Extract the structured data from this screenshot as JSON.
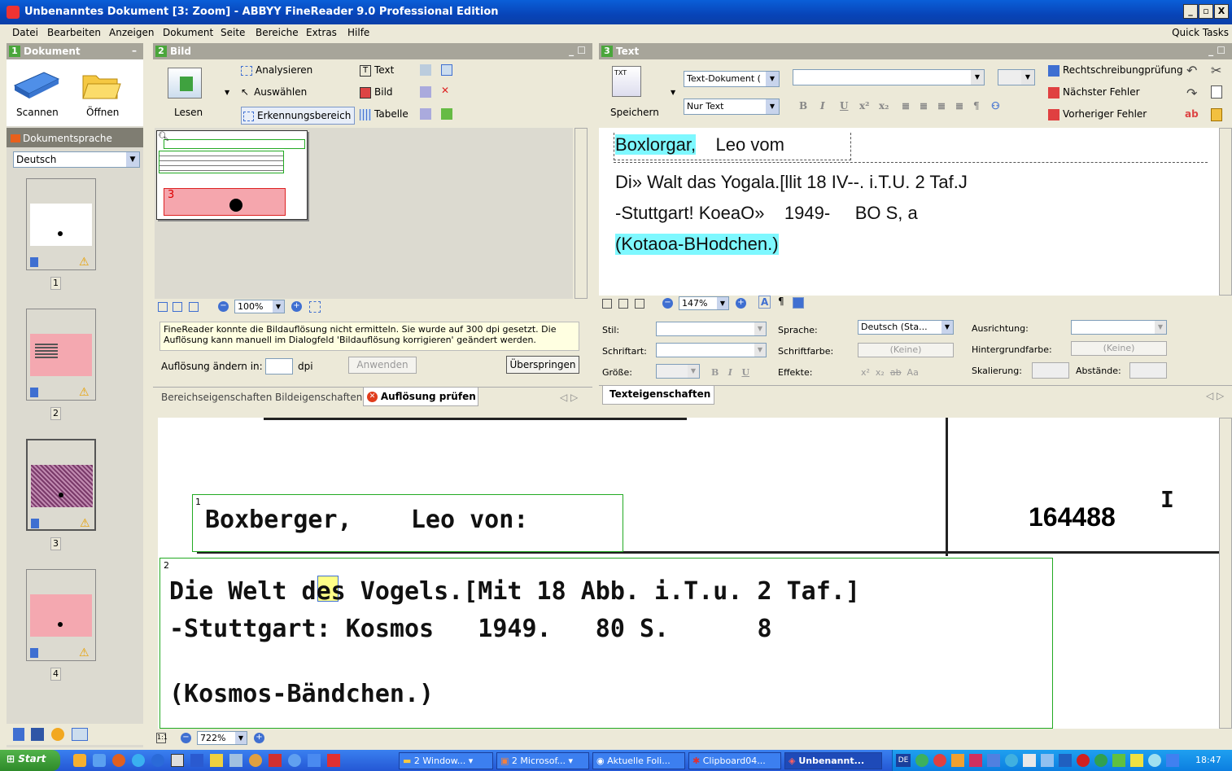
{
  "window": {
    "title": "Unbenanntes Dokument [3: Zoom] - ABBYY FineReader 9.0 Professional Edition"
  },
  "menu": [
    "Datei",
    "Bearbeiten",
    "Anzeigen",
    "Dokument",
    "Seite",
    "Bereiche",
    "Extras",
    "Hilfe"
  ],
  "quick_tasks": "Quick Tasks",
  "doc_pane": {
    "num": "1",
    "title": "Dokument",
    "scan": "Scannen",
    "open": "Öffnen",
    "lang_label": "Dokumentsprache",
    "lang_value": "Deutsch",
    "pages": [
      "1",
      "2",
      "3",
      "4"
    ]
  },
  "image_pane": {
    "num": "2",
    "title": "Bild",
    "read": "Lesen",
    "tools": [
      "Analysieren",
      "Auswählen",
      "Erkennungsbereich"
    ],
    "areas": [
      "Text",
      "Bild",
      "Tabelle"
    ],
    "zoom": "100%",
    "area3": "3",
    "message": "FineReader konnte die Bildauflösung nicht ermitteln. Sie wurde auf 300 dpi gesetzt. Die Auflösung kann manuell im Dialogfeld 'Bildauflösung korrigieren' geändert werden.",
    "res_label": "Auflösung ändern in:",
    "res_unit": "dpi",
    "apply": "Anwenden",
    "skip": "Überspringen",
    "tabs": [
      "Bereichseigenschaften",
      "Bildeigenschaften",
      "Auflösung prüfen"
    ]
  },
  "text_pane": {
    "num": "3",
    "title": "Text",
    "save": "Speichern",
    "format": "Text-Dokument (",
    "mode": "Nur Text",
    "spell": "Rechtschreibungprüfung",
    "next_err": "Nächster Fehler",
    "prev_err": "Vorheriger Fehler",
    "zoom": "147%",
    "lines": [
      [
        "Boxlorgar,",
        "Leo vom"
      ],
      [
        "Di» Walt das Yogala.[llit 18 IV--. i.T.U. 2 Taf.J"
      ],
      [
        "-Stuttgart! KoeaO»    1949-     BO S, a"
      ],
      [
        "(Kotaoa-BHodchen.)"
      ]
    ],
    "props": {
      "style": "Stil:",
      "font": "Schriftart:",
      "size": "Größe:",
      "lang": "Sprache:",
      "lang_val": "Deutsch (Sta...",
      "color": "Schriftfarbe:",
      "color_val": "(Keine)",
      "effects": "Effekte:",
      "align": "Ausrichtung:",
      "bg": "Hintergrundfarbe:",
      "bg_val": "(Keine)",
      "scale": "Skalierung:",
      "spacing": "Abstände:"
    },
    "tab": "Texteigenschaften"
  },
  "zoom_pane": {
    "zoom": "722%",
    "block1_num": "1",
    "block2_num": "2",
    "line1": "Boxberger,    Leo von:",
    "num1": "164488",
    "mark": "I",
    "line2": "Die Welt des Vogels.[Mit 18 Abb. i.T.u. 2 Taf.]",
    "line3": "-Stuttgart: Kosmos   1949.   80 S.      8",
    "line4": "(Kosmos-Bändchen.)"
  },
  "taskbar": {
    "start": "Start",
    "items": [
      "2 Window...",
      "2 Microsof...",
      "Aktuelle Foli...",
      "Clipboard04...",
      "Unbenannt..."
    ],
    "lang": "DE",
    "time": "18:47"
  }
}
